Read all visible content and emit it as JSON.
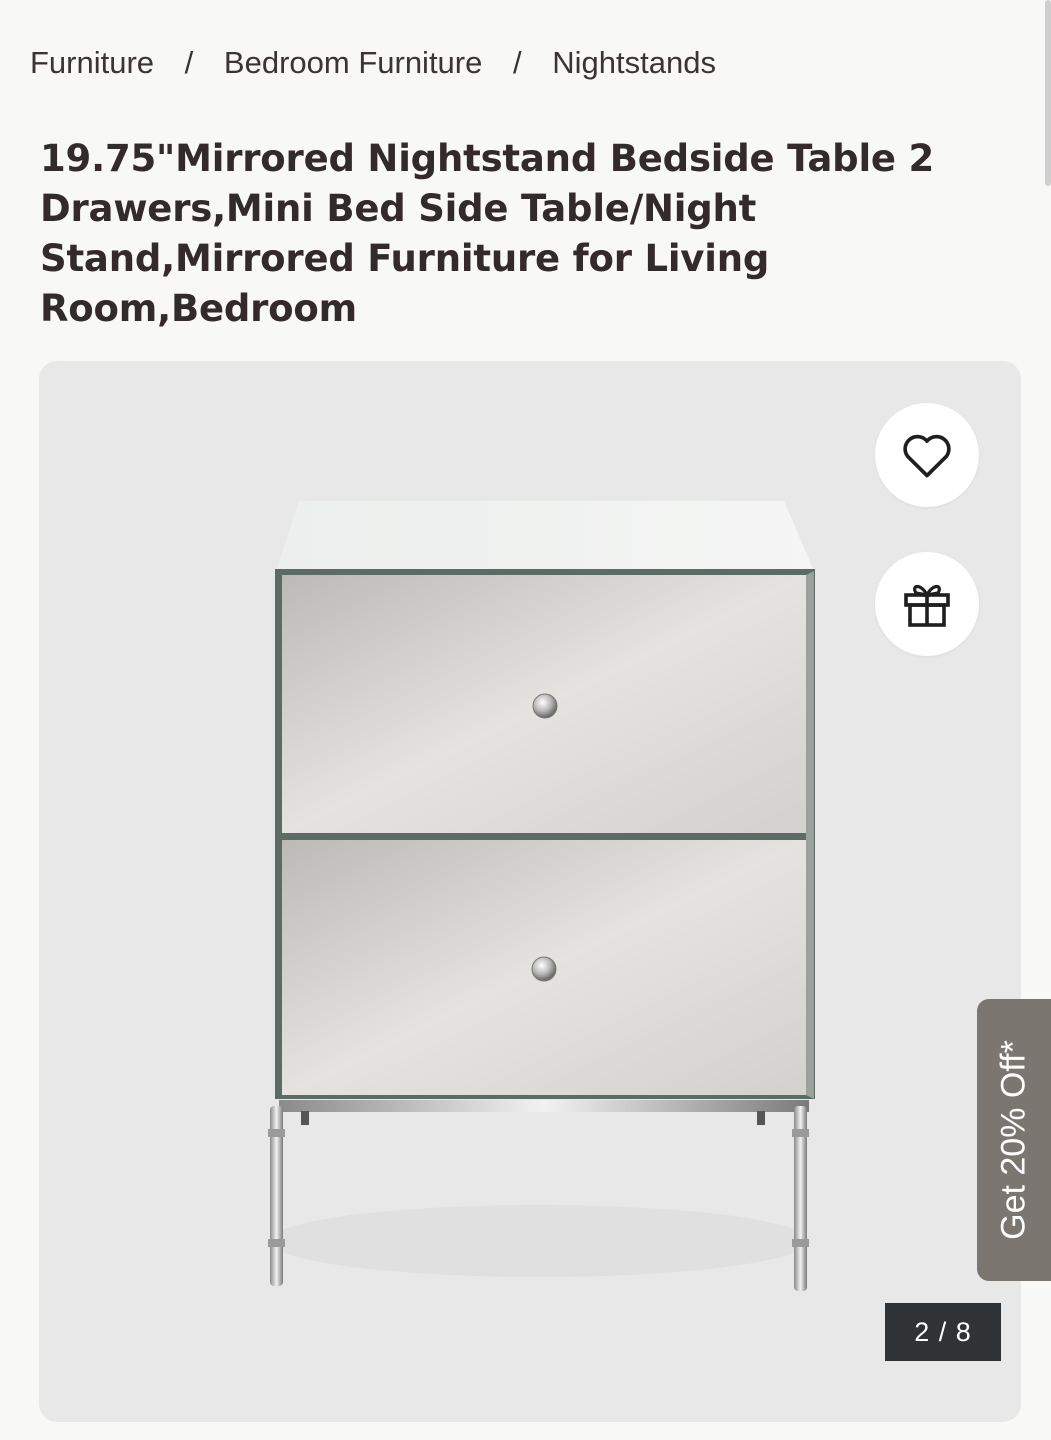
{
  "breadcrumb": {
    "items": [
      "Furniture",
      "Bedroom Furniture",
      "Nightstands"
    ],
    "separator": "/"
  },
  "product": {
    "title": "19.75\"Mirrored Nightstand Bedside Table 2 Drawers,Mini Bed Side Table/Night Stand,Mirrored Furniture for Living Room,Bedroom"
  },
  "gallery": {
    "image_counter": "2 / 8",
    "icons": {
      "wishlist": "heart-icon",
      "gift": "gift-icon"
    }
  },
  "promo": {
    "label": "Get 20% Off*"
  },
  "colors": {
    "background": "#f8f8f6",
    "gallery_background": "#e8e8e8",
    "counter_background": "#2f3336",
    "promo_background": "#7c7670",
    "title_text": "#332a2a"
  }
}
